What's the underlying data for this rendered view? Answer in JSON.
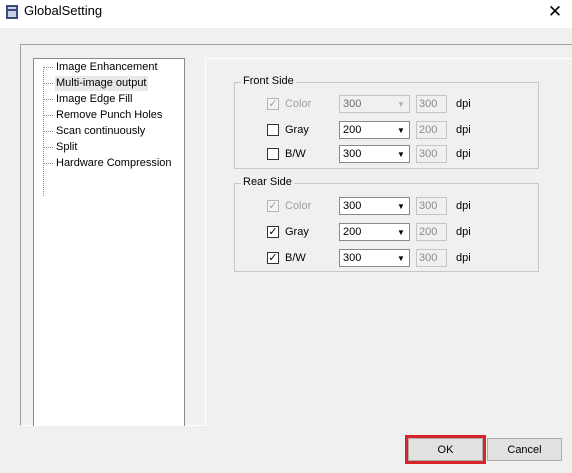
{
  "window": {
    "title": "GlobalSetting",
    "close_glyph": "✕",
    "app_icon": "scanner-icon"
  },
  "tree": {
    "items": [
      {
        "label": "Image Enhancement",
        "selected": false
      },
      {
        "label": "Multi-image output",
        "selected": true
      },
      {
        "label": "Image Edge Fill",
        "selected": false
      },
      {
        "label": "Remove Punch Holes",
        "selected": false
      },
      {
        "label": "Scan continuously",
        "selected": false
      },
      {
        "label": "Split",
        "selected": false
      },
      {
        "label": "Hardware Compression",
        "selected": false
      }
    ]
  },
  "front_side": {
    "legend": "Front Side",
    "rows": [
      {
        "label": "Color",
        "checked": true,
        "enabled": false,
        "combo": "300",
        "combo_enabled": false,
        "field": "300",
        "unit": "dpi"
      },
      {
        "label": "Gray",
        "checked": false,
        "enabled": true,
        "combo": "200",
        "combo_enabled": true,
        "field": "200",
        "unit": "dpi"
      },
      {
        "label": "B/W",
        "checked": false,
        "enabled": true,
        "combo": "300",
        "combo_enabled": true,
        "field": "300",
        "unit": "dpi"
      }
    ]
  },
  "rear_side": {
    "legend": "Rear Side",
    "rows": [
      {
        "label": "Color",
        "checked": true,
        "enabled": false,
        "combo": "300",
        "combo_enabled": true,
        "field": "300",
        "unit": "dpi"
      },
      {
        "label": "Gray",
        "checked": true,
        "enabled": true,
        "combo": "200",
        "combo_enabled": true,
        "field": "200",
        "unit": "dpi"
      },
      {
        "label": "B/W",
        "checked": true,
        "enabled": true,
        "combo": "300",
        "combo_enabled": true,
        "field": "300",
        "unit": "dpi"
      }
    ]
  },
  "buttons": {
    "ok": "OK",
    "cancel": "Cancel"
  },
  "colors": {
    "highlight_frame": "#d6242a"
  }
}
